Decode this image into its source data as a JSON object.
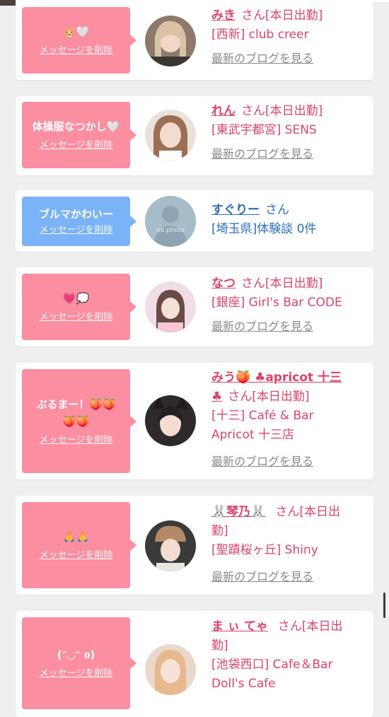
{
  "common": {
    "delete_label": "メッセージを削除",
    "blog_label": "最新のブログを見る",
    "san": "さん",
    "on_duty": "[本日出勤]"
  },
  "items": [
    {
      "message": "🐹🤍",
      "name": "みき",
      "store": "[西新] club creer"
    },
    {
      "message": "体操服なつかし🤍",
      "name": "れん",
      "store": "[東武宇都宮] SENS"
    },
    {
      "message": "ブルマかわいー",
      "name": "すぐりー",
      "store": "[埼玉県]体験談 0件",
      "no_photo": "no photo"
    },
    {
      "message": "💗💭",
      "name": "なつ",
      "store": "[銀座] Girl's Bar CODE"
    },
    {
      "message_line1": "ぶるまー！🍑🍑",
      "message_line2": "🍑🍑",
      "name_line1": "みう🍑 ♣apricot 十三",
      "name_line2": "♣",
      "store_line1": "[十三] Café & Bar",
      "store_line2": "Apricot 十三店"
    },
    {
      "message": "🙏🙏",
      "name": "🐰琴乃🐰",
      "duty_line1": "[本日出",
      "duty_line2": "勤]",
      "store": "[聖蹟桜ヶ丘] Shiny"
    },
    {
      "message": "(ᵔ◡ᵔ ი)",
      "name": "ま ぃ てゃ",
      "duty_line1": "[本日出",
      "duty_line2": "勤]",
      "store_line1": "[池袋西口] Cafe＆Bar",
      "store_line2": "Doll's Cafe"
    }
  ],
  "colors": {
    "pink_bubble": "#fb8ea0",
    "blue_bubble": "#7ab3f7",
    "name_pink": "#d9456a",
    "name_blue": "#2d6fb8"
  }
}
